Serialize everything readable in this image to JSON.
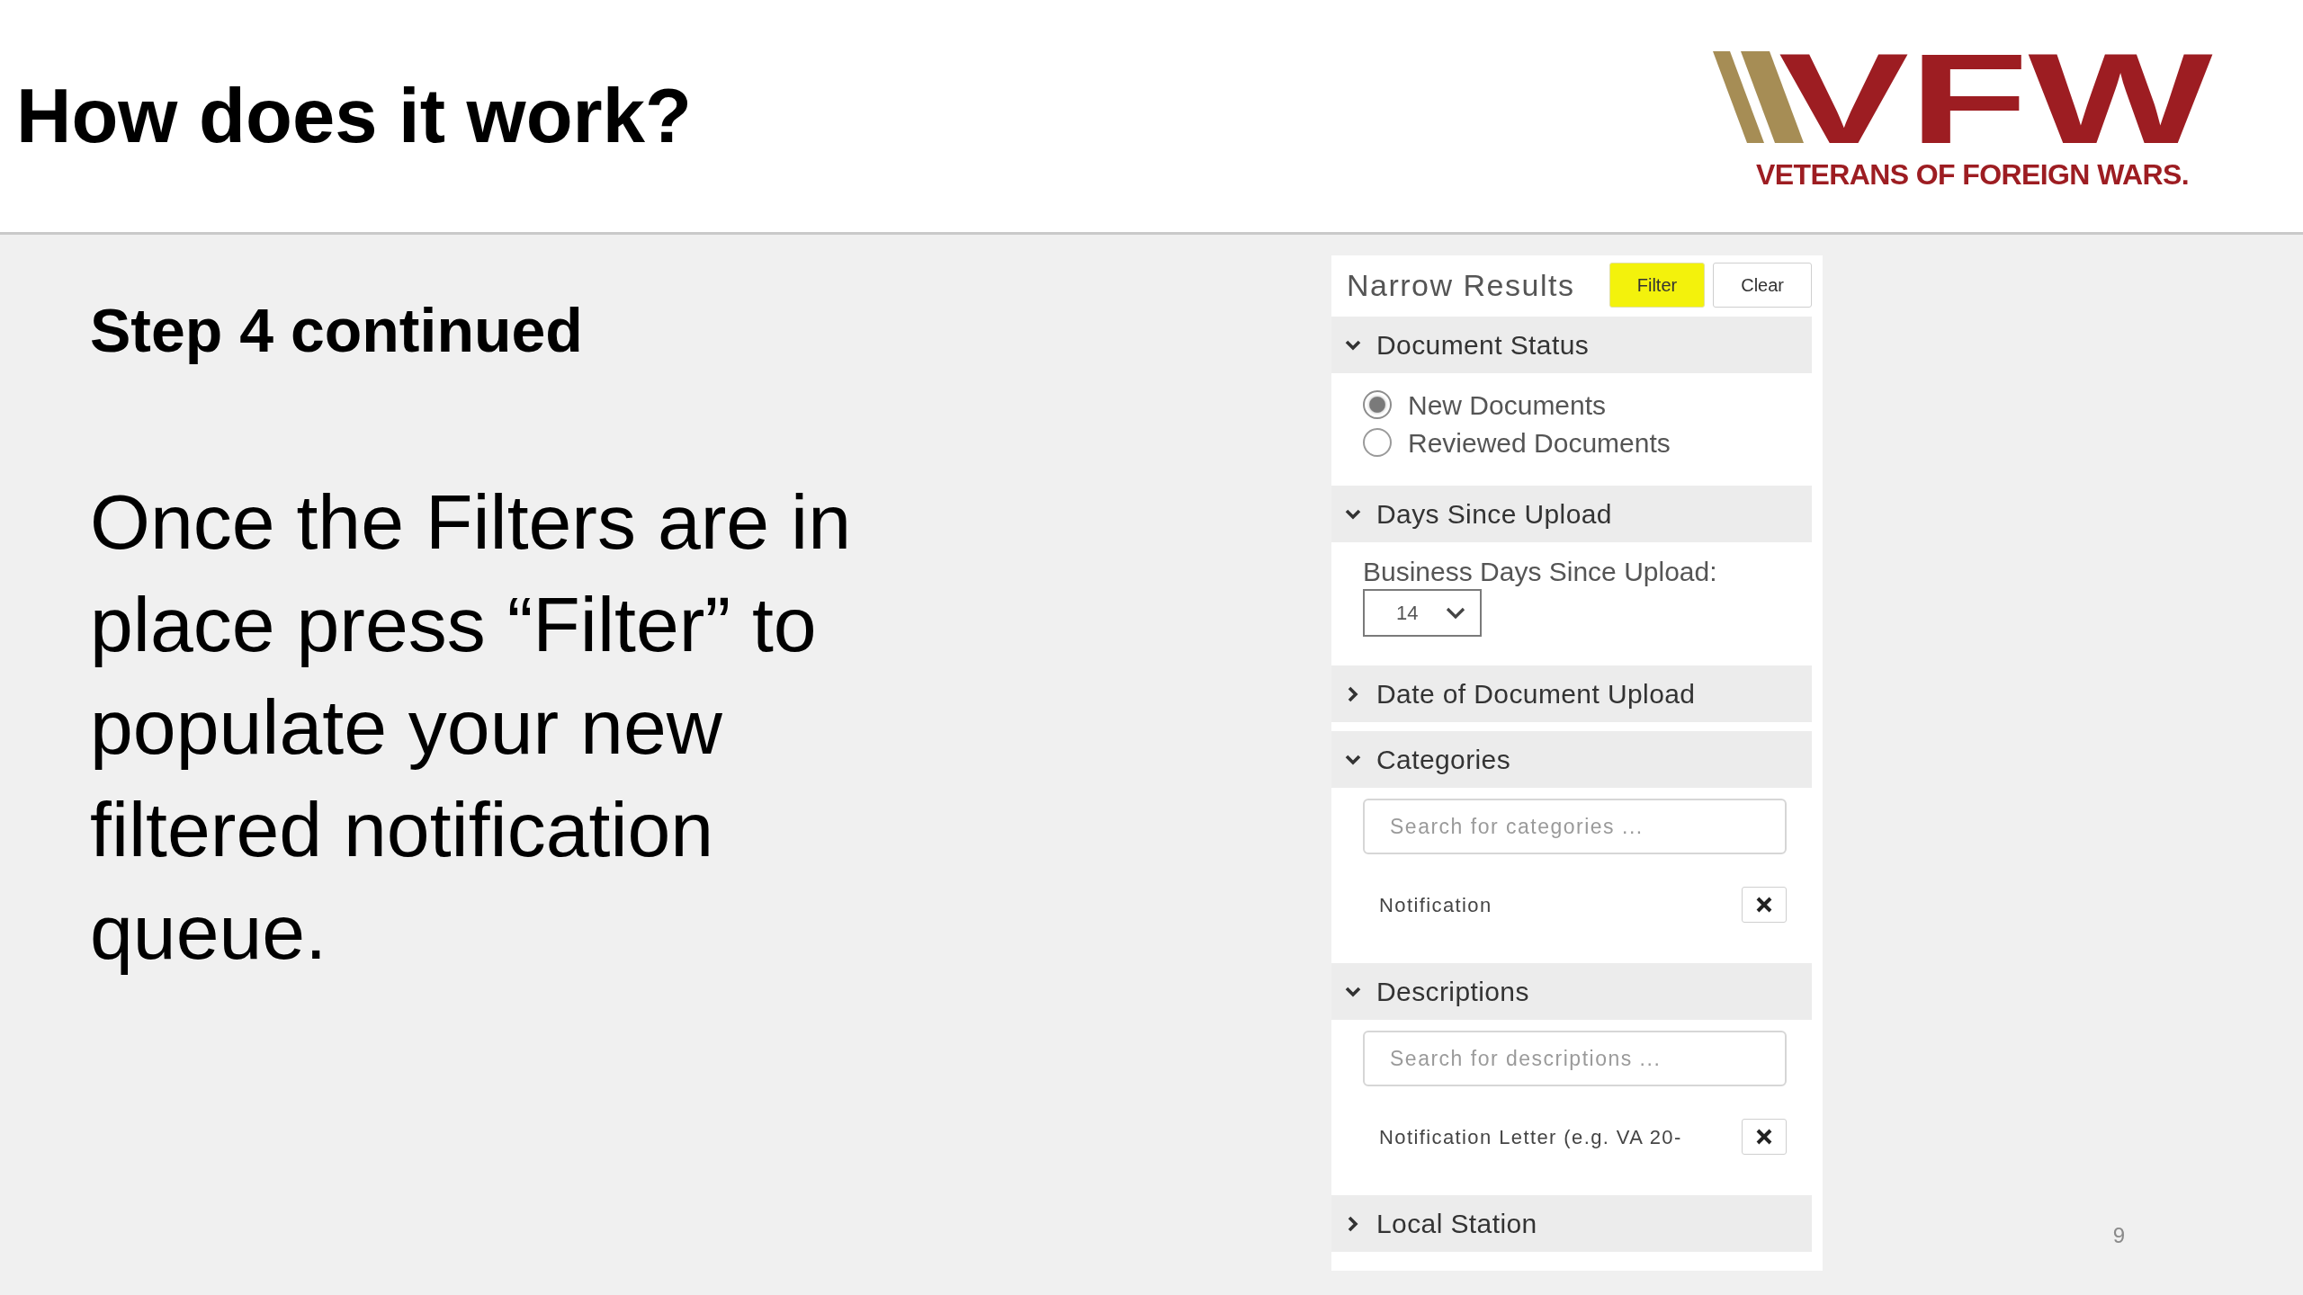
{
  "slide": {
    "title": "How does it work?",
    "logo": {
      "wordmark": "VFW",
      "tagline": "VETERANS OF FOREIGN WARS."
    },
    "subtitle": "Step 4 continued",
    "body": "Once the Filters are in place press “Filter” to populate your new filtered notification queue.",
    "page_number": "9"
  },
  "panel": {
    "title": "Narrow Results",
    "buttons": [
      {
        "label": "Filter",
        "highlighted": true
      },
      {
        "label": "Clear",
        "highlighted": false
      }
    ],
    "sections": [
      {
        "title": "Document Status",
        "expanded": true,
        "kind": "radios",
        "options": [
          {
            "label": "New Documents",
            "selected": true
          },
          {
            "label": "Reviewed Documents",
            "selected": false
          }
        ]
      },
      {
        "title": "Days Since Upload",
        "expanded": true,
        "kind": "select",
        "label": "Business Days Since Upload:",
        "value": "14"
      },
      {
        "title": "Date of Document Upload",
        "expanded": false
      },
      {
        "title": "Categories",
        "expanded": true,
        "kind": "search",
        "placeholder": "Search for categories ...",
        "items": [
          "Notification"
        ]
      },
      {
        "title": "Descriptions",
        "expanded": true,
        "kind": "search",
        "placeholder": "Search for descriptions ...",
        "items": [
          "Notification Letter (e.g. VA 20-"
        ]
      },
      {
        "title": "Local Station",
        "expanded": false
      }
    ]
  }
}
